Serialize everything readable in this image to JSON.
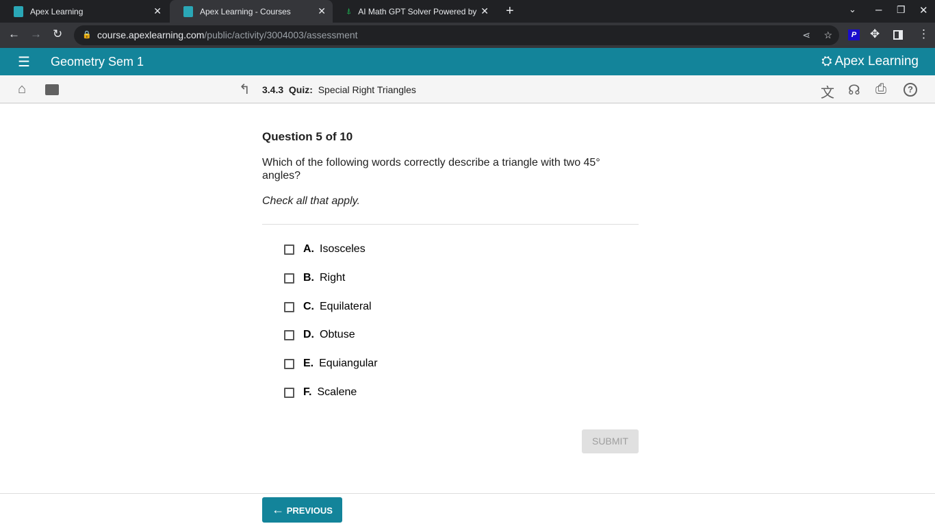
{
  "browser": {
    "tabs": [
      {
        "label": "Apex Learning"
      },
      {
        "label": "Apex Learning - Courses"
      },
      {
        "label": "AI Math GPT Solver Powered by"
      }
    ],
    "url_host": "course.apexlearning.com",
    "url_path": "/public/activity/3004003/assessment",
    "extension_label": "P"
  },
  "header": {
    "title": "Geometry Sem 1",
    "logo": "Apex Learning"
  },
  "subheader": {
    "number": "3.4.3",
    "type": "Quiz:",
    "name": "Special Right Triangles"
  },
  "question": {
    "counter": "Question 5 of 10",
    "text": "Which of the following words correctly describe a triangle with two 45° angles?",
    "instruction": "Check all that apply.",
    "options": [
      {
        "letter": "A.",
        "label": "Isosceles"
      },
      {
        "letter": "B.",
        "label": "Right"
      },
      {
        "letter": "C.",
        "label": "Equilateral"
      },
      {
        "letter": "D.",
        "label": "Obtuse"
      },
      {
        "letter": "E.",
        "label": "Equiangular"
      },
      {
        "letter": "F.",
        "label": "Scalene"
      }
    ]
  },
  "buttons": {
    "submit": "SUBMIT",
    "previous": "PREVIOUS"
  },
  "colors": {
    "brand": "#13849a"
  }
}
